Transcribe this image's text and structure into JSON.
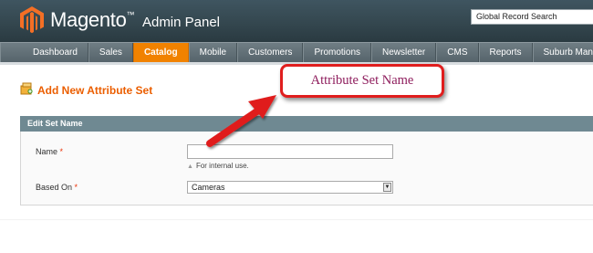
{
  "header": {
    "brand_name": "Magento",
    "brand_tm": "™",
    "brand_sub": "Admin Panel",
    "search_select_value": "Global Record Search"
  },
  "nav": {
    "items": [
      {
        "label": "Dashboard"
      },
      {
        "label": "Sales"
      },
      {
        "label": "Catalog"
      },
      {
        "label": "Mobile"
      },
      {
        "label": "Customers"
      },
      {
        "label": "Promotions"
      },
      {
        "label": "Newsletter"
      },
      {
        "label": "CMS"
      },
      {
        "label": "Reports"
      },
      {
        "label": "Suburb Manage"
      }
    ],
    "active": "Catalog"
  },
  "page": {
    "title": "Add New Attribute Set"
  },
  "form": {
    "section_title": "Edit Set Name",
    "name_label": "Name",
    "name_value": "",
    "name_note": "For internal use.",
    "based_on_label": "Based On",
    "based_on_value": "Cameras",
    "required_mark": "*"
  },
  "annotation": {
    "callout_text": "Attribute Set Name"
  },
  "colors": {
    "accent": "#eb5e00",
    "active_tab": "#f18200",
    "header": "#34474f",
    "section_header": "#6f8992",
    "callout_border": "#e01e1e",
    "callout_text": "#8e1c5c"
  },
  "icons": {
    "logo": "magento-logo-icon",
    "title": "attribute-set-icon",
    "note": "note-arrow-icon",
    "select": "dropdown-arrow-icon",
    "arrow": "red-arrow-icon"
  }
}
